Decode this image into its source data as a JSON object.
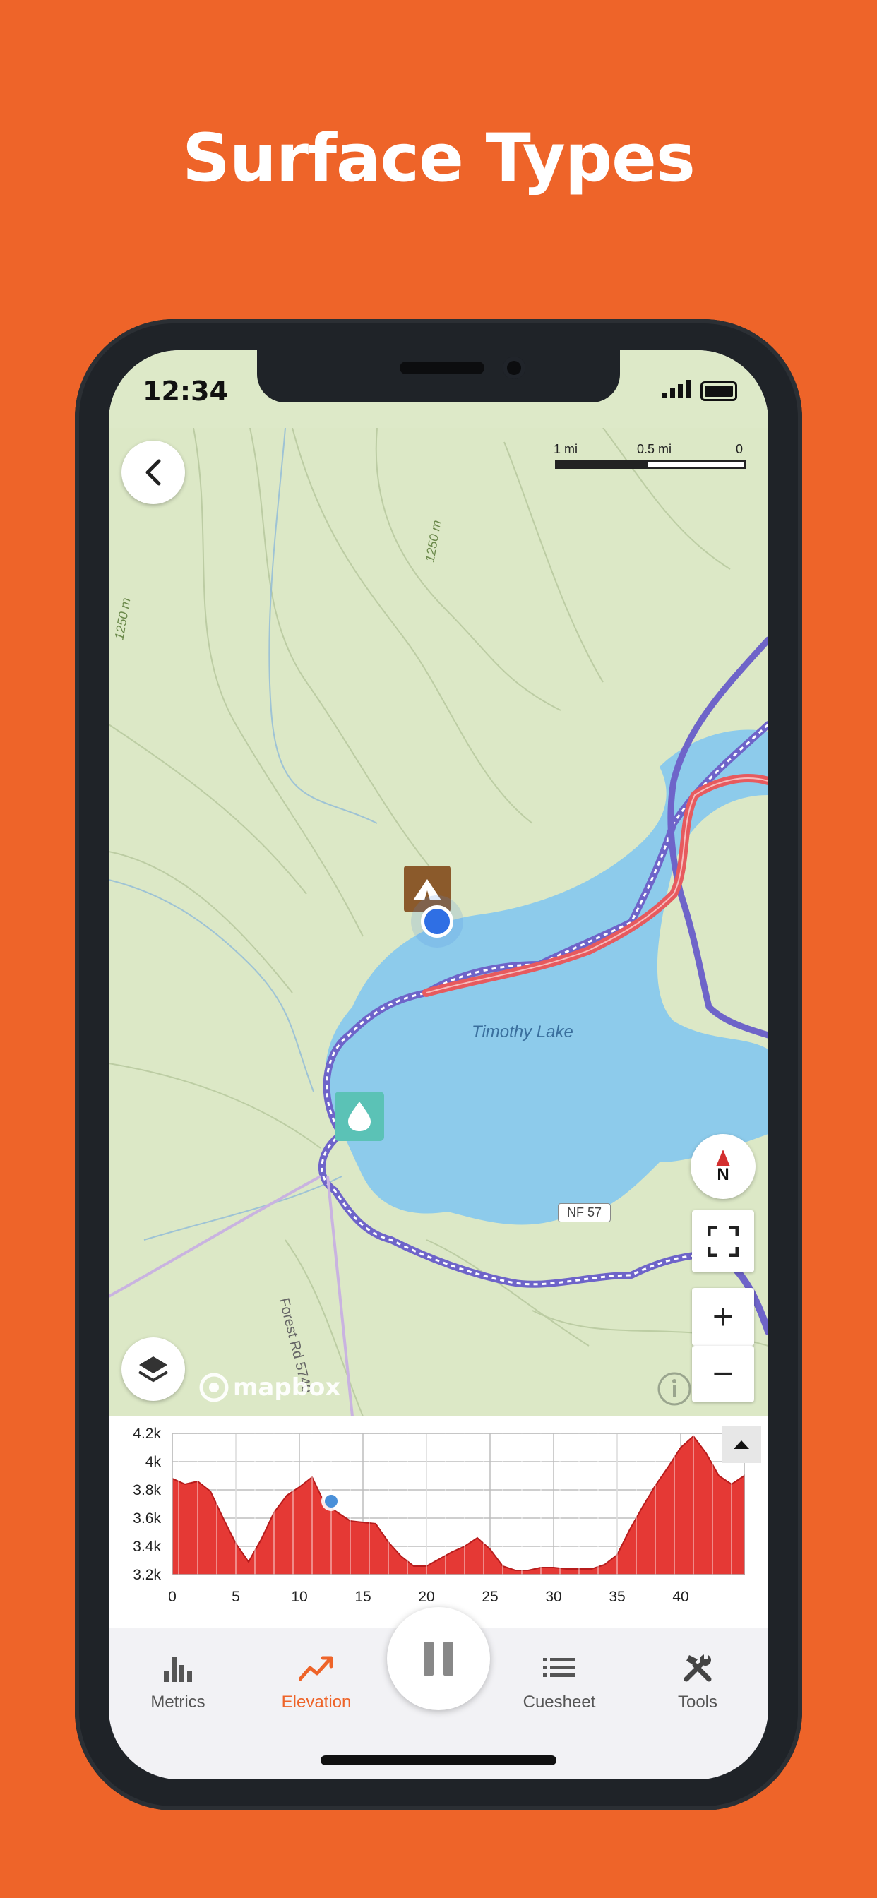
{
  "headline": "Surface Types",
  "status": {
    "time": "12:34"
  },
  "map": {
    "scale": {
      "left": "1 mi",
      "mid": "0.5 mi",
      "right": "0"
    },
    "lake_label": "Timothy Lake",
    "contour_labels": [
      "1250 m",
      "1250 m"
    ],
    "road_label": "Forest Rd 5740",
    "road_shield": "NF 57",
    "attribution": "mapbox",
    "compass": "N",
    "buttons": {
      "zoom_in": "+",
      "zoom_out": "−"
    }
  },
  "elevation_chart": {
    "chart_data": {
      "type": "area",
      "ylabel": "",
      "xlabel": "",
      "ylim": [
        3200,
        4200
      ],
      "xlim": [
        0,
        45
      ],
      "y_ticks": [
        "4.2k",
        "4k",
        "3.8k",
        "3.6k",
        "3.4k",
        "3.2k"
      ],
      "x_ticks": [
        "0",
        "5",
        "10",
        "15",
        "20",
        "25",
        "30",
        "35",
        "40"
      ],
      "series": [
        {
          "x": [
            0,
            1,
            2,
            3,
            4,
            5,
            6,
            7,
            8,
            9,
            10,
            11,
            12,
            13,
            14,
            15,
            16,
            17,
            18,
            19,
            20,
            21,
            22,
            23,
            24,
            25,
            26,
            27,
            28,
            29,
            30,
            31,
            32,
            33,
            34,
            35,
            36,
            37,
            38,
            39,
            40,
            41,
            42,
            43,
            44,
            45
          ],
          "values": [
            3880,
            3840,
            3860,
            3790,
            3600,
            3420,
            3290,
            3450,
            3640,
            3760,
            3820,
            3890,
            3700,
            3640,
            3580,
            3570,
            3560,
            3430,
            3330,
            3260,
            3260,
            3310,
            3360,
            3400,
            3460,
            3380,
            3260,
            3230,
            3230,
            3250,
            3250,
            3240,
            3240,
            3240,
            3270,
            3340,
            3520,
            3680,
            3830,
            3960,
            4100,
            4180,
            4060,
            3900,
            3840,
            3900
          ]
        }
      ],
      "marker": {
        "x": 12.5,
        "y": 3720
      }
    },
    "colors": {
      "fill": "#E53935",
      "grid": "#BDBDBD",
      "marker": "#4A90D9"
    }
  },
  "tabs": [
    {
      "label": "Metrics",
      "icon": "bar-chart-icon"
    },
    {
      "label": "Elevation",
      "icon": "trend-line-icon"
    },
    {
      "label": "Cuesheet",
      "icon": "list-icon"
    },
    {
      "label": "Tools",
      "icon": "tools-icon"
    }
  ],
  "colors": {
    "accent": "#EE6429",
    "route_purple": "#6E64C9",
    "route_red": "#E75A5E",
    "lake": "#8DCBEB"
  }
}
